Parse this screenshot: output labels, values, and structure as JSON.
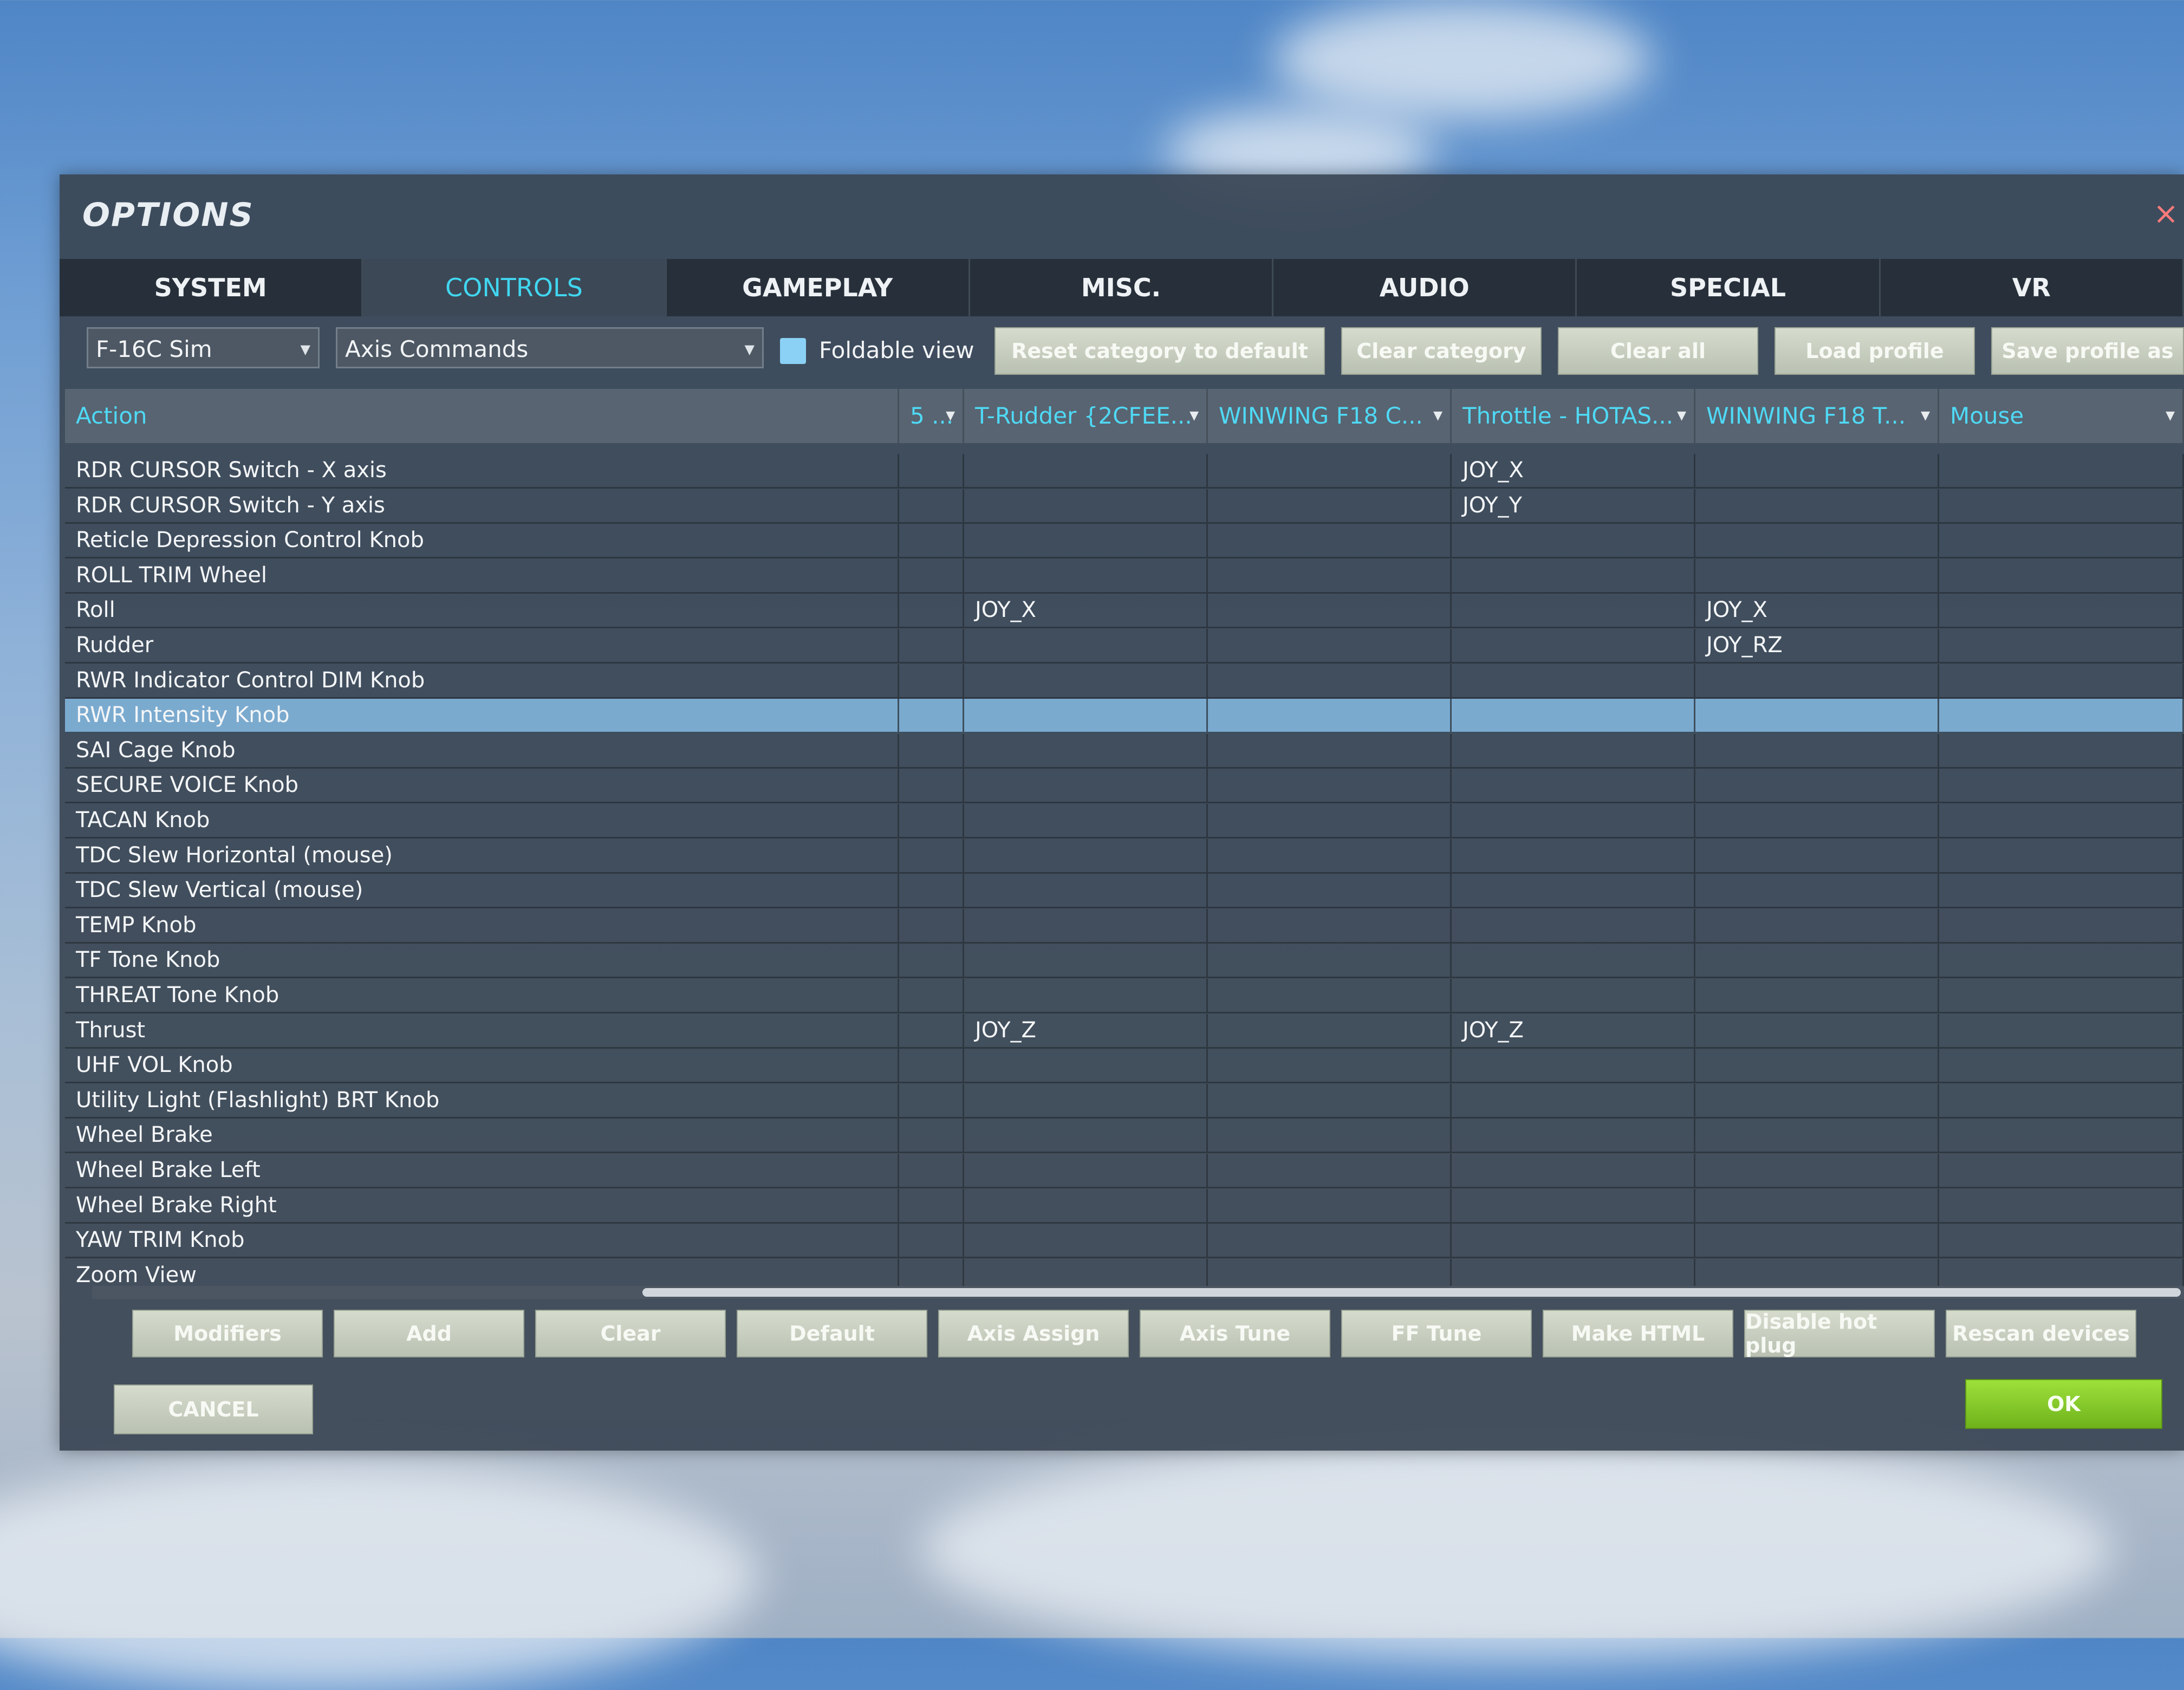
{
  "window": {
    "title": "OPTIONS",
    "close_icon": "×"
  },
  "tabs": [
    {
      "label": "SYSTEM",
      "active": false
    },
    {
      "label": "CONTROLS",
      "active": true
    },
    {
      "label": "GAMEPLAY",
      "active": false
    },
    {
      "label": "MISC.",
      "active": false
    },
    {
      "label": "AUDIO",
      "active": false
    },
    {
      "label": "SPECIAL",
      "active": false
    },
    {
      "label": "VR",
      "active": false
    }
  ],
  "toolbar": {
    "aircraft_select": "F-16C Sim",
    "category_select": "Axis Commands",
    "foldable_view_label": "Foldable view",
    "foldable_view_checked": false,
    "reset_category": "Reset category to default",
    "clear_category": "Clear category",
    "clear_all": "Clear all",
    "load_profile": "Load profile",
    "save_profile_as": "Save profile as"
  },
  "grid": {
    "columns": [
      {
        "label": "Action"
      },
      {
        "label": "5 ..."
      },
      {
        "label": "T-Rudder {2CFEE..."
      },
      {
        "label": "WINWING F18 C..."
      },
      {
        "label": "Throttle - HOTAS..."
      },
      {
        "label": "WINWING F18 T..."
      },
      {
        "label": "Mouse"
      }
    ],
    "rows": [
      {
        "action": "RDR CURSOR Switch - X axis",
        "c1": "",
        "c2": "",
        "c3": "",
        "c4": "JOY_X",
        "c5": "",
        "c6": ""
      },
      {
        "action": "RDR CURSOR Switch - Y axis",
        "c1": "",
        "c2": "",
        "c3": "",
        "c4": "JOY_Y",
        "c5": "",
        "c6": ""
      },
      {
        "action": "Reticle Depression Control Knob",
        "c1": "",
        "c2": "",
        "c3": "",
        "c4": "",
        "c5": "",
        "c6": ""
      },
      {
        "action": "ROLL TRIM Wheel",
        "c1": "",
        "c2": "",
        "c3": "",
        "c4": "",
        "c5": "",
        "c6": ""
      },
      {
        "action": "Roll",
        "c1": "",
        "c2": "JOY_X",
        "c3": "",
        "c4": "",
        "c5": "JOY_X",
        "c6": ""
      },
      {
        "action": "Rudder",
        "c1": "",
        "c2": "",
        "c3": "",
        "c4": "",
        "c5": "JOY_RZ",
        "c6": ""
      },
      {
        "action": "RWR Indicator Control DIM Knob",
        "c1": "",
        "c2": "",
        "c3": "",
        "c4": "",
        "c5": "",
        "c6": ""
      },
      {
        "action": "RWR Intensity Knob",
        "c1": "",
        "c2": "",
        "c3": "",
        "c4": "",
        "c5": "",
        "c6": "",
        "selected": true
      },
      {
        "action": "SAI Cage Knob",
        "c1": "",
        "c2": "",
        "c3": "",
        "c4": "",
        "c5": "",
        "c6": ""
      },
      {
        "action": "SECURE VOICE Knob",
        "c1": "",
        "c2": "",
        "c3": "",
        "c4": "",
        "c5": "",
        "c6": ""
      },
      {
        "action": "TACAN Knob",
        "c1": "",
        "c2": "",
        "c3": "",
        "c4": "",
        "c5": "",
        "c6": ""
      },
      {
        "action": "TDC Slew Horizontal (mouse)",
        "c1": "",
        "c2": "",
        "c3": "",
        "c4": "",
        "c5": "",
        "c6": ""
      },
      {
        "action": "TDC Slew Vertical (mouse)",
        "c1": "",
        "c2": "",
        "c3": "",
        "c4": "",
        "c5": "",
        "c6": ""
      },
      {
        "action": "TEMP Knob",
        "c1": "",
        "c2": "",
        "c3": "",
        "c4": "",
        "c5": "",
        "c6": ""
      },
      {
        "action": "TF Tone Knob",
        "c1": "",
        "c2": "",
        "c3": "",
        "c4": "",
        "c5": "",
        "c6": ""
      },
      {
        "action": "THREAT Tone Knob",
        "c1": "",
        "c2": "",
        "c3": "",
        "c4": "",
        "c5": "",
        "c6": ""
      },
      {
        "action": "Thrust",
        "c1": "",
        "c2": "JOY_Z",
        "c3": "",
        "c4": "JOY_Z",
        "c5": "",
        "c6": ""
      },
      {
        "action": "UHF VOL Knob",
        "c1": "",
        "c2": "",
        "c3": "",
        "c4": "",
        "c5": "",
        "c6": ""
      },
      {
        "action": "Utility Light (Flashlight) BRT Knob",
        "c1": "",
        "c2": "",
        "c3": "",
        "c4": "",
        "c5": "",
        "c6": ""
      },
      {
        "action": "Wheel Brake",
        "c1": "",
        "c2": "",
        "c3": "",
        "c4": "",
        "c5": "",
        "c6": ""
      },
      {
        "action": "Wheel Brake Left",
        "c1": "",
        "c2": "",
        "c3": "",
        "c4": "",
        "c5": "",
        "c6": ""
      },
      {
        "action": "Wheel Brake Right",
        "c1": "",
        "c2": "",
        "c3": "",
        "c4": "",
        "c5": "",
        "c6": ""
      },
      {
        "action": "YAW TRIM Knob",
        "c1": "",
        "c2": "",
        "c3": "",
        "c4": "",
        "c5": "",
        "c6": ""
      },
      {
        "action": "Zoom View",
        "c1": "",
        "c2": "",
        "c3": "",
        "c4": "",
        "c5": "",
        "c6": ""
      }
    ]
  },
  "bottom_buttons": [
    "Modifiers",
    "Add",
    "Clear",
    "Default",
    "Axis Assign",
    "Axis Tune",
    "FF Tune",
    "Make HTML",
    "Disable hot plug",
    "Rescan devices"
  ],
  "footer": {
    "cancel": "CANCEL",
    "ok": "OK"
  },
  "colors": {
    "accent_cyan": "#41d6f0",
    "ok_green": "#8bd12c",
    "selected_row": "#8cc4f0"
  }
}
